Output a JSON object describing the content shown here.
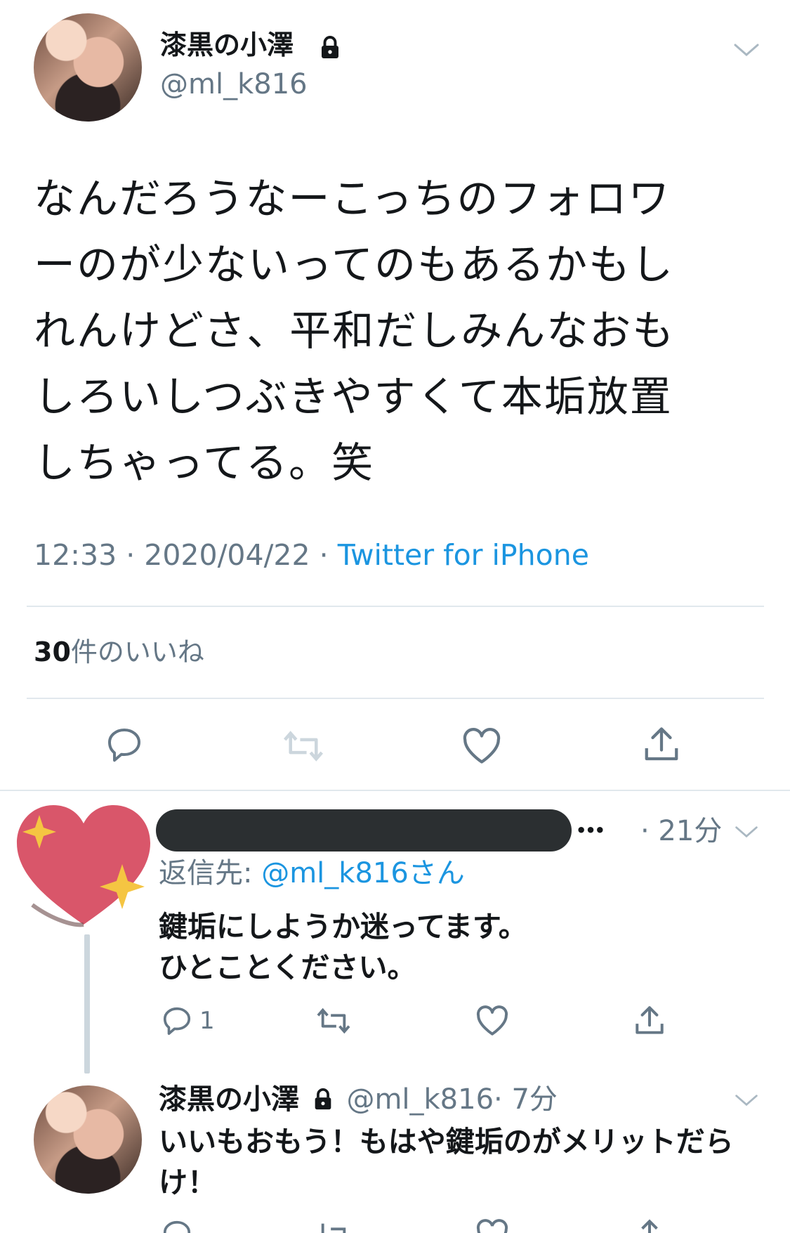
{
  "main_tweet": {
    "display_name": "漆黒の小澤",
    "handle": "@ml_k816",
    "text_lines": [
      "なんだろうなーこっちのフォロワ",
      "ーのが少ないってのもあるかもし",
      "れんけどさ、平和だしみんなおも",
      "しろいしつぶきやすくて本垢放置",
      "しちゃってる。笑"
    ],
    "time": "12:33",
    "date": "2020/04/22",
    "source": "Twitter for iPhone",
    "likes_count": "30",
    "likes_label": "件のいいね"
  },
  "reply": {
    "more": "•••",
    "time": "· 21分",
    "reply_to_label": "返信先: ",
    "reply_to_handle": "@ml_k816さん",
    "text_lines": [
      "鍵垢にしようか迷ってます。",
      "ひとことください。"
    ],
    "reply_count": "1"
  },
  "second_reply": {
    "display_name": "漆黒の小澤",
    "handle": "@ml_k816",
    "time": "· 7分",
    "text_lines": [
      "いいもおもう！もはや鍵垢のがメリットだら",
      "け！"
    ]
  },
  "icons": {
    "reply": "reply-bubble-icon",
    "retweet": "retweet-icon",
    "like": "heart-icon",
    "share": "share-icon",
    "lock": "lock-icon",
    "chevron": "chevron-down-icon"
  },
  "colors": {
    "link": "#1b95e0",
    "muted": "#657786",
    "heart_emoji": "#d9566a",
    "sparkle": "#f5c542"
  }
}
